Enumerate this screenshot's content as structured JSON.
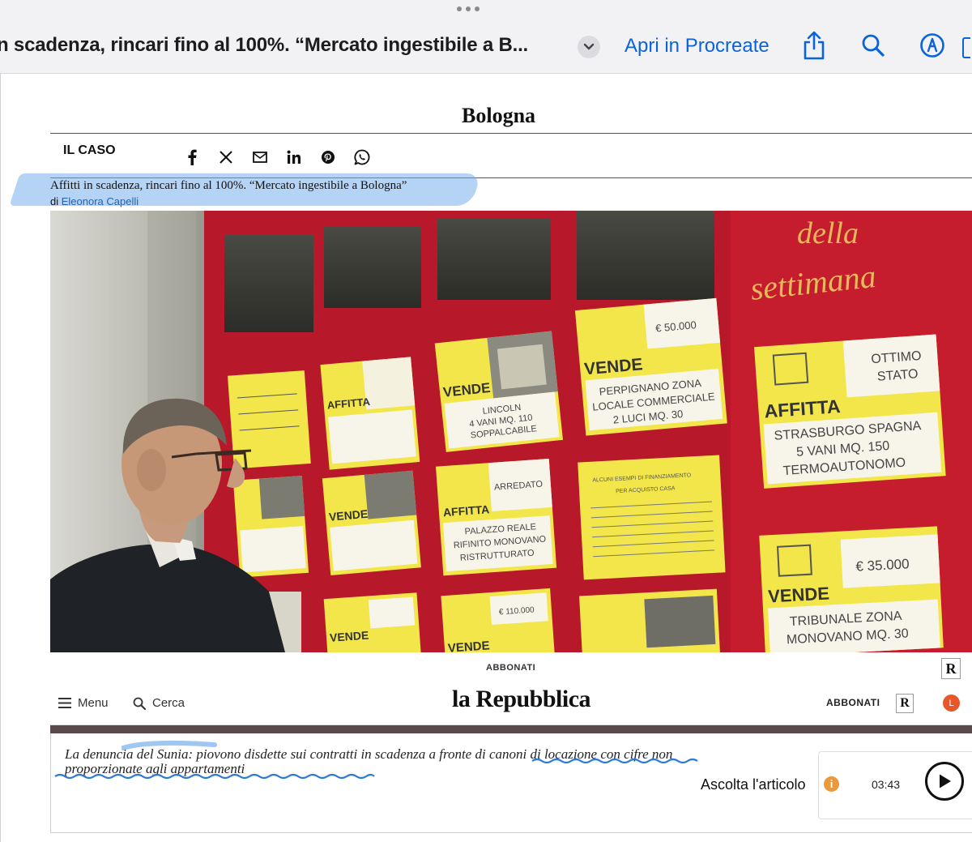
{
  "app_bar": {
    "document_title": "n scadenza, rincari fino al 100%. “Mercato ingestibile a B...",
    "open_in_label": "Apri in Procreate",
    "icons": [
      "share-icon",
      "search-icon",
      "markup-icon"
    ]
  },
  "article": {
    "section": "Bologna",
    "kicker": "IL CASO",
    "share_icons": [
      "facebook-icon",
      "x-icon",
      "email-icon",
      "linkedin-icon",
      "pinterest-icon",
      "whatsapp-icon"
    ],
    "headline": "Affitti in scadenza, rincari fino al 100%. “Mercato ingestibile a Bologna”",
    "byline_prefix": "di",
    "author": "Eleonora Capelli",
    "photo_signs": {
      "top_right_1": "della",
      "top_right_2": "settimana",
      "vende": "VENDE",
      "affitta": "AFFITTA",
      "price_1": "€ 50.000",
      "price_2": "€ 35.000",
      "price_3": "€ 110.000",
      "ottimo": "OTTIMO",
      "stato": "STATO",
      "arredato": "ARREDATO",
      "sign_a_1": "PERPIGNANO ZONA",
      "sign_a_2": "LOCALE COMMERCIALE",
      "sign_a_3": "2 LUCI MQ. 30",
      "sign_b_1": "STRASBURGO SPAGNA",
      "sign_b_2": "5 VANI MQ. 150",
      "sign_b_3": "TERMOAUTONOMO",
      "sign_c_1": "LINCOLN",
      "sign_c_2": "4 VANI MQ. 110",
      "sign_c_3": "SOPPALCABILE",
      "sign_d_1": "PALAZZO REALE",
      "sign_d_2": "RIFINITO MONOVANO",
      "sign_d_3": "RISTRUTTURATO",
      "sign_e_1": "TRIBUNALE ZONA",
      "sign_e_2": "MONOVANO MQ. 30",
      "sign_f_1": "ALCUNI ESEMPI DI FINANZIAMENTO",
      "sign_f_2": "PER ACQUISTO CASA"
    }
  },
  "repubblica_bar": {
    "abbonati_top": "ABBONATI",
    "r_badge": "R",
    "menu_label": "Menu",
    "search_label": "Cerca",
    "logo": "la Repubblica",
    "abbonati_nav": "ABBONATI",
    "avatar_initial": "L"
  },
  "caption": {
    "text_part1": "La denuncia del Sunia:",
    "text_part2": " piovono disdette sui contratti in scadenza a fronte di canoni di locazione con cifre non proporzionate agli appartamenti"
  },
  "audio_player": {
    "listen_label": "Ascolta l'articolo",
    "info_icon": "i",
    "duration": "03:43"
  },
  "colors": {
    "accent_blue": "#0a64d8",
    "highlight": "#78afeb",
    "board_red": "#c8102e",
    "sign_yellow": "#f5e94a",
    "avatar_orange": "#e8572a"
  }
}
